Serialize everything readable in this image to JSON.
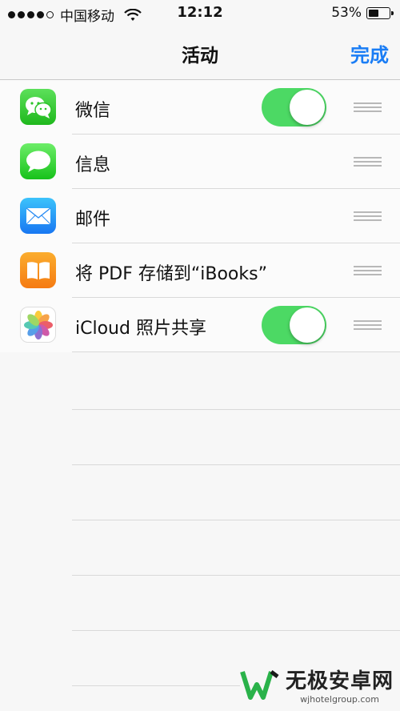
{
  "status": {
    "carrier": "中国移动",
    "time": "12:12",
    "battery_percent_text": "53%",
    "battery_level": 0.53
  },
  "nav": {
    "title": "活动",
    "done_label": "完成"
  },
  "activities": [
    {
      "label": "微信",
      "icon": "wechat-icon",
      "toggle": true
    },
    {
      "label": "信息",
      "icon": "messages-icon",
      "toggle": null
    },
    {
      "label": "邮件",
      "icon": "mail-icon",
      "toggle": null
    },
    {
      "label": "将 PDF 存储到“iBooks”",
      "icon": "ibooks-icon",
      "toggle": null
    },
    {
      "label": "iCloud 照片共享",
      "icon": "photos-icon",
      "toggle": true
    }
  ],
  "watermark": {
    "title": "无极安卓网",
    "url": "wjhotelgroup.com"
  },
  "colors": {
    "accent": "#1a7df5",
    "toggle_on": "#4cd964"
  }
}
